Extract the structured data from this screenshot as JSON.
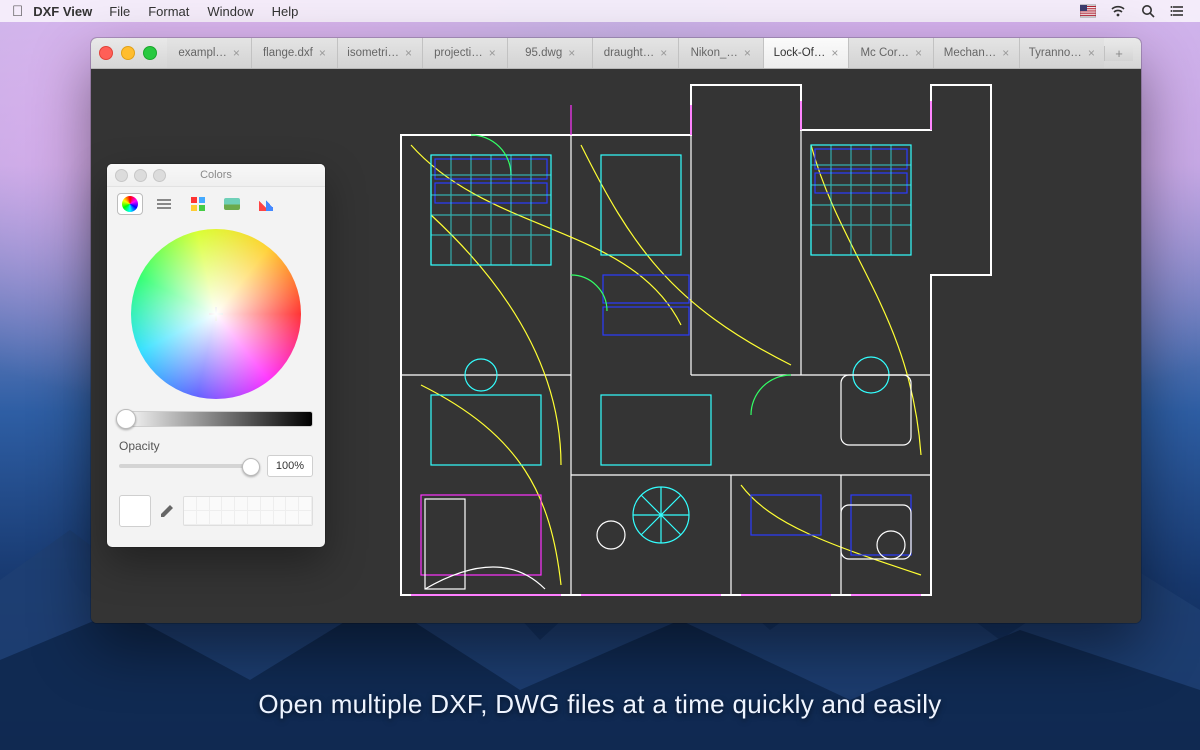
{
  "menubar": {
    "app_name": "DXF View",
    "items": [
      "File",
      "Format",
      "Window",
      "Help"
    ]
  },
  "tabs": [
    {
      "label": "exampl…",
      "active": false
    },
    {
      "label": "flange.dxf",
      "active": false
    },
    {
      "label": "isometri…",
      "active": false
    },
    {
      "label": "projecti…",
      "active": false
    },
    {
      "label": "95.dwg",
      "active": false
    },
    {
      "label": "draught…",
      "active": false
    },
    {
      "label": "Nikon_…",
      "active": false
    },
    {
      "label": "Lock-Of…",
      "active": true
    },
    {
      "label": "Mc Cor…",
      "active": false
    },
    {
      "label": "Mechan…",
      "active": false
    },
    {
      "label": "Tyranno…",
      "active": false
    }
  ],
  "colors_panel": {
    "title": "Colors",
    "opacity_label": "Opacity",
    "opacity_value": "100%"
  },
  "caption": "Open multiple DXF, DWG files at a time quickly and easily"
}
